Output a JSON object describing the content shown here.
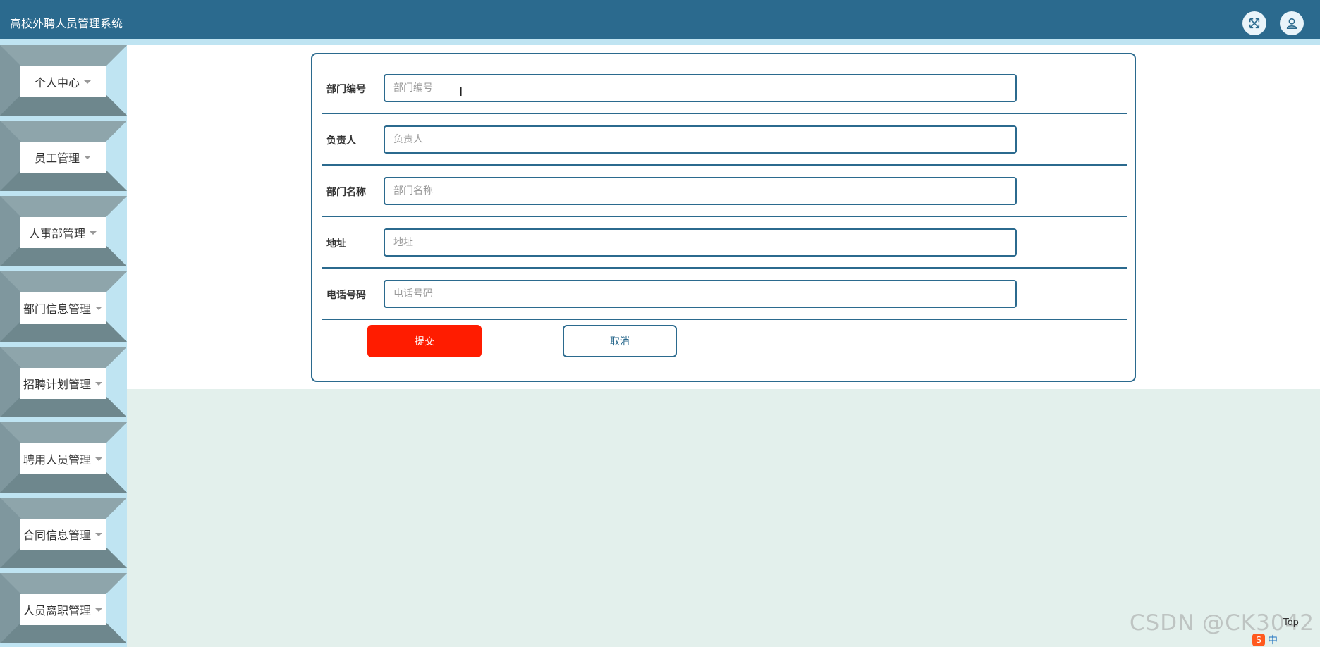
{
  "app": {
    "title": "高校外聘人员管理系统"
  },
  "topbar": {
    "fullscreen_icon": "fullscreen-icon",
    "user_icon": "user-icon"
  },
  "sidebar": {
    "items": [
      {
        "label": "个人中心"
      },
      {
        "label": "员工管理"
      },
      {
        "label": "人事部管理"
      },
      {
        "label": "部门信息管理"
      },
      {
        "label": "招聘计划管理"
      },
      {
        "label": "聘用人员管理"
      },
      {
        "label": "合同信息管理"
      },
      {
        "label": "人员离职管理"
      }
    ]
  },
  "form": {
    "fields": [
      {
        "label": "部门编号",
        "placeholder": "部门编号",
        "value": ""
      },
      {
        "label": "负责人",
        "placeholder": "负责人",
        "value": ""
      },
      {
        "label": "部门名称",
        "placeholder": "部门名称",
        "value": ""
      },
      {
        "label": "地址",
        "placeholder": "地址",
        "value": ""
      },
      {
        "label": "电话号码",
        "placeholder": "电话号码",
        "value": ""
      }
    ],
    "submit_label": "提交",
    "cancel_label": "取消"
  },
  "colors": {
    "primary": "#2b6a8e",
    "submit": "#ff1c00",
    "sidebar_bg": "#bfe4f2",
    "page_bg": "#e3f0ec"
  },
  "footer": {
    "watermark": "CSDN @CK3042",
    "top_link": "Top",
    "ime_status": "中"
  }
}
